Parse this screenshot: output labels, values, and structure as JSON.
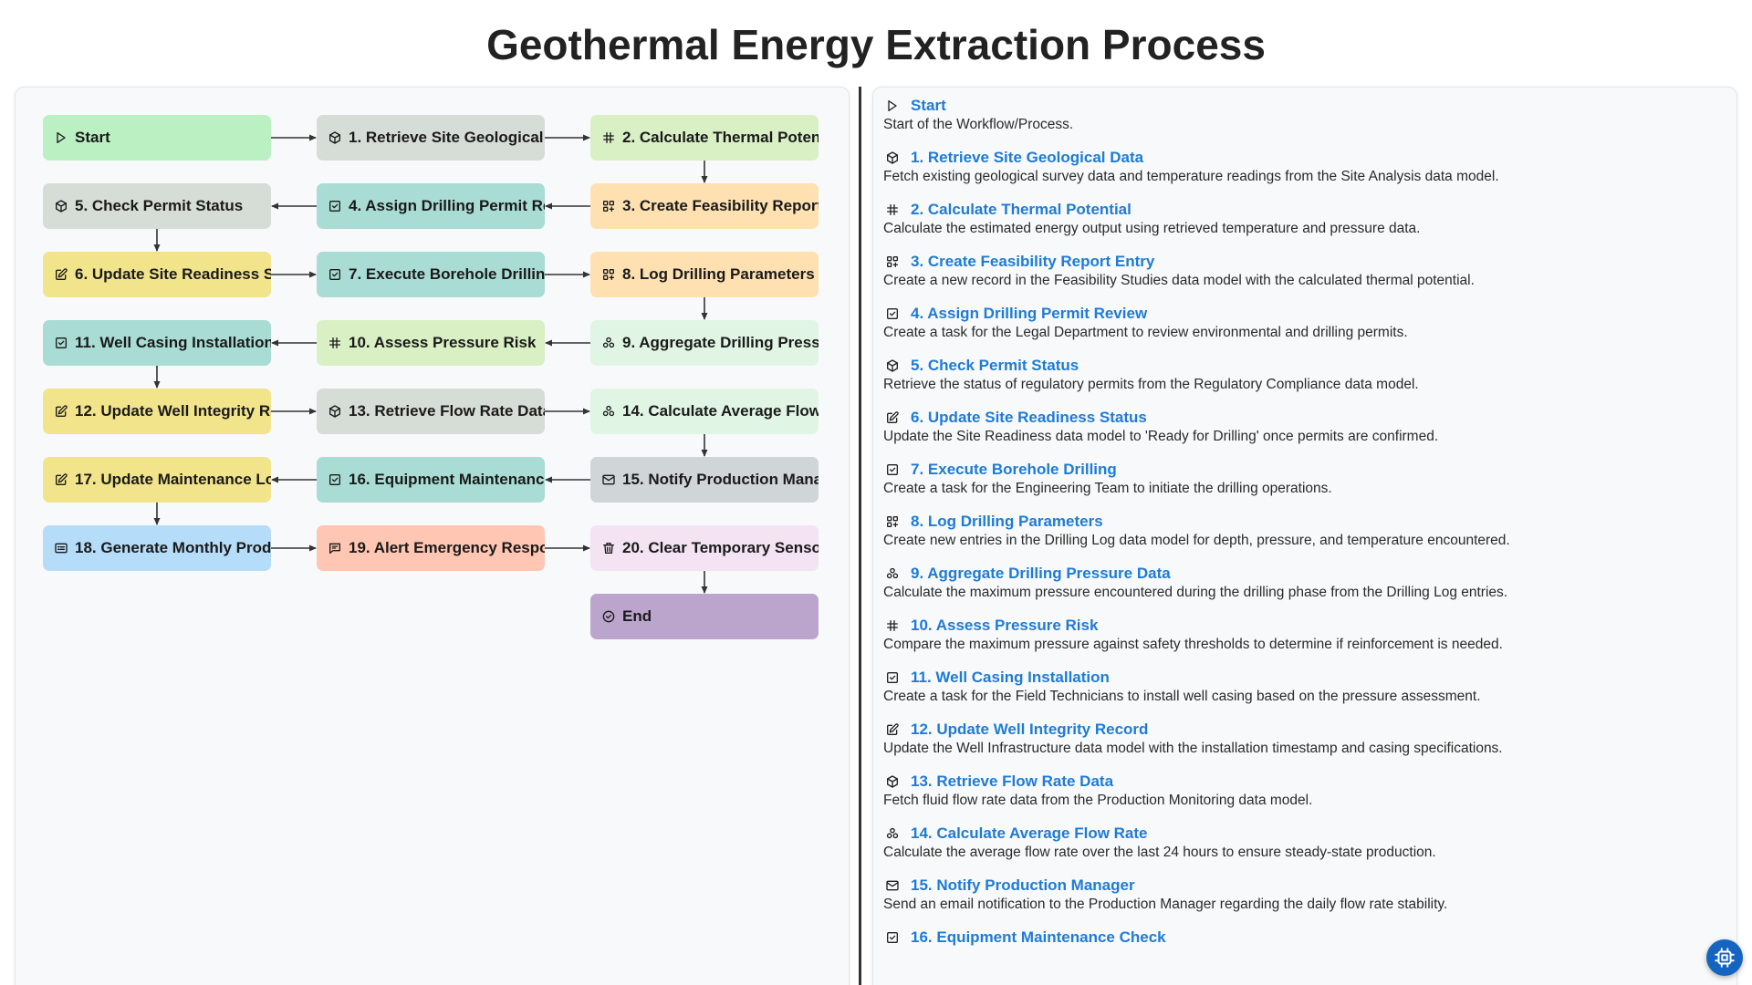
{
  "title": "Geothermal Energy Extraction Process",
  "colors": {
    "green": "#bbf0c3",
    "gray": "#d6ddd6",
    "lime": "#d9efc4",
    "orange": "#ffe0b0",
    "teal": "#a9dcd4",
    "yellow": "#f2e48a",
    "mint": "#e0f5e4",
    "blue": "#b5dcf8",
    "salmon": "#ffc7b3",
    "pink": "#f3e3f3",
    "slate": "#d0d5d8",
    "purple": "#bca5cc",
    "link": "#1e7bd6",
    "fab": "#1565c0"
  },
  "nodes": [
    {
      "id": "start",
      "label": "Start",
      "icon": "play-icon",
      "color": "green"
    },
    {
      "id": "n1",
      "label": "1. Retrieve Site Geological",
      "icon": "cube-icon",
      "color": "gray"
    },
    {
      "id": "n2",
      "label": "2. Calculate Thermal Poten",
      "icon": "hash-icon",
      "color": "lime"
    },
    {
      "id": "n3",
      "label": "3. Create Feasibility Report",
      "icon": "grid-plus-icon",
      "color": "orange"
    },
    {
      "id": "n4",
      "label": "4. Assign Drilling Permit Re",
      "icon": "checkbox-icon",
      "color": "teal"
    },
    {
      "id": "n5",
      "label": "5. Check Permit Status",
      "icon": "cube-icon",
      "color": "gray"
    },
    {
      "id": "n6",
      "label": "6. Update Site Readiness S",
      "icon": "edit-icon",
      "color": "yellow"
    },
    {
      "id": "n7",
      "label": "7. Execute Borehole Drilling",
      "icon": "checkbox-icon",
      "color": "teal"
    },
    {
      "id": "n8",
      "label": "8. Log Drilling Parameters",
      "icon": "grid-plus-icon",
      "color": "orange"
    },
    {
      "id": "n9",
      "label": "9. Aggregate Drilling Press",
      "icon": "stack-icon",
      "color": "mint"
    },
    {
      "id": "n10",
      "label": "10. Assess Pressure Risk",
      "icon": "hash-icon",
      "color": "lime"
    },
    {
      "id": "n11",
      "label": "11. Well Casing Installation",
      "icon": "checkbox-icon",
      "color": "teal"
    },
    {
      "id": "n12",
      "label": "12. Update Well Integrity Re",
      "icon": "edit-icon",
      "color": "yellow"
    },
    {
      "id": "n13",
      "label": "13. Retrieve Flow Rate Data",
      "icon": "cube-icon",
      "color": "gray"
    },
    {
      "id": "n14",
      "label": "14. Calculate Average Flow",
      "icon": "stack-icon",
      "color": "mint"
    },
    {
      "id": "n15",
      "label": "15. Notify Production Mana",
      "icon": "mail-icon",
      "color": "slate"
    },
    {
      "id": "n16",
      "label": "16. Equipment Maintenance",
      "icon": "checkbox-icon",
      "color": "teal"
    },
    {
      "id": "n17",
      "label": "17. Update Maintenance Lo",
      "icon": "edit-icon",
      "color": "yellow"
    },
    {
      "id": "n18",
      "label": "18. Generate Monthly Prod",
      "icon": "report-icon",
      "color": "blue"
    },
    {
      "id": "n19",
      "label": "19. Alert Emergency Respo",
      "icon": "message-icon",
      "color": "salmon"
    },
    {
      "id": "n20",
      "label": "20. Clear Temporary Senso",
      "icon": "trash-icon",
      "color": "pink"
    },
    {
      "id": "end",
      "label": "End",
      "icon": "check-circle-icon",
      "color": "purple"
    }
  ],
  "steps": [
    {
      "title": "Start",
      "icon": "play-icon",
      "desc": "Start of the Workflow/Process."
    },
    {
      "title": "1. Retrieve Site Geological Data",
      "icon": "cube-icon",
      "desc": "Fetch existing geological survey data and temperature readings from the Site Analysis data model."
    },
    {
      "title": "2. Calculate Thermal Potential",
      "icon": "hash-icon",
      "desc": "Calculate the estimated energy output using retrieved temperature and pressure data."
    },
    {
      "title": "3. Create Feasibility Report Entry",
      "icon": "grid-plus-icon",
      "desc": "Create a new record in the Feasibility Studies data model with the calculated thermal potential."
    },
    {
      "title": "4. Assign Drilling Permit Review",
      "icon": "checkbox-icon",
      "desc": "Create a task for the Legal Department to review environmental and drilling permits."
    },
    {
      "title": "5. Check Permit Status",
      "icon": "cube-icon",
      "desc": "Retrieve the status of regulatory permits from the Regulatory Compliance data model."
    },
    {
      "title": "6. Update Site Readiness Status",
      "icon": "edit-icon",
      "desc": "Update the Site Readiness data model to 'Ready for Drilling' once permits are confirmed."
    },
    {
      "title": "7. Execute Borehole Drilling",
      "icon": "checkbox-icon",
      "desc": "Create a task for the Engineering Team to initiate the drilling operations."
    },
    {
      "title": "8. Log Drilling Parameters",
      "icon": "grid-plus-icon",
      "desc": "Create new entries in the Drilling Log data model for depth, pressure, and temperature encountered."
    },
    {
      "title": "9. Aggregate Drilling Pressure Data",
      "icon": "stack-icon",
      "desc": "Calculate the maximum pressure encountered during the drilling phase from the Drilling Log entries."
    },
    {
      "title": "10. Assess Pressure Risk",
      "icon": "hash-icon",
      "desc": "Compare the maximum pressure against safety thresholds to determine if reinforcement is needed."
    },
    {
      "title": "11. Well Casing Installation",
      "icon": "checkbox-icon",
      "desc": "Create a task for the Field Technicians to install well casing based on the pressure assessment."
    },
    {
      "title": "12. Update Well Integrity Record",
      "icon": "edit-icon",
      "desc": "Update the Well Infrastructure data model with the installation timestamp and casing specifications."
    },
    {
      "title": "13. Retrieve Flow Rate Data",
      "icon": "cube-icon",
      "desc": "Fetch fluid flow rate data from the Production Monitoring data model."
    },
    {
      "title": "14. Calculate Average Flow Rate",
      "icon": "stack-icon",
      "desc": "Calculate the average flow rate over the last 24 hours to ensure steady-state production."
    },
    {
      "title": "15. Notify Production Manager",
      "icon": "mail-icon",
      "desc": "Send an email notification to the Production Manager regarding the daily flow rate stability."
    },
    {
      "title": "16. Equipment Maintenance Check",
      "icon": "checkbox-icon",
      "desc": ""
    }
  ],
  "fab": {
    "icon": "chip-icon"
  }
}
